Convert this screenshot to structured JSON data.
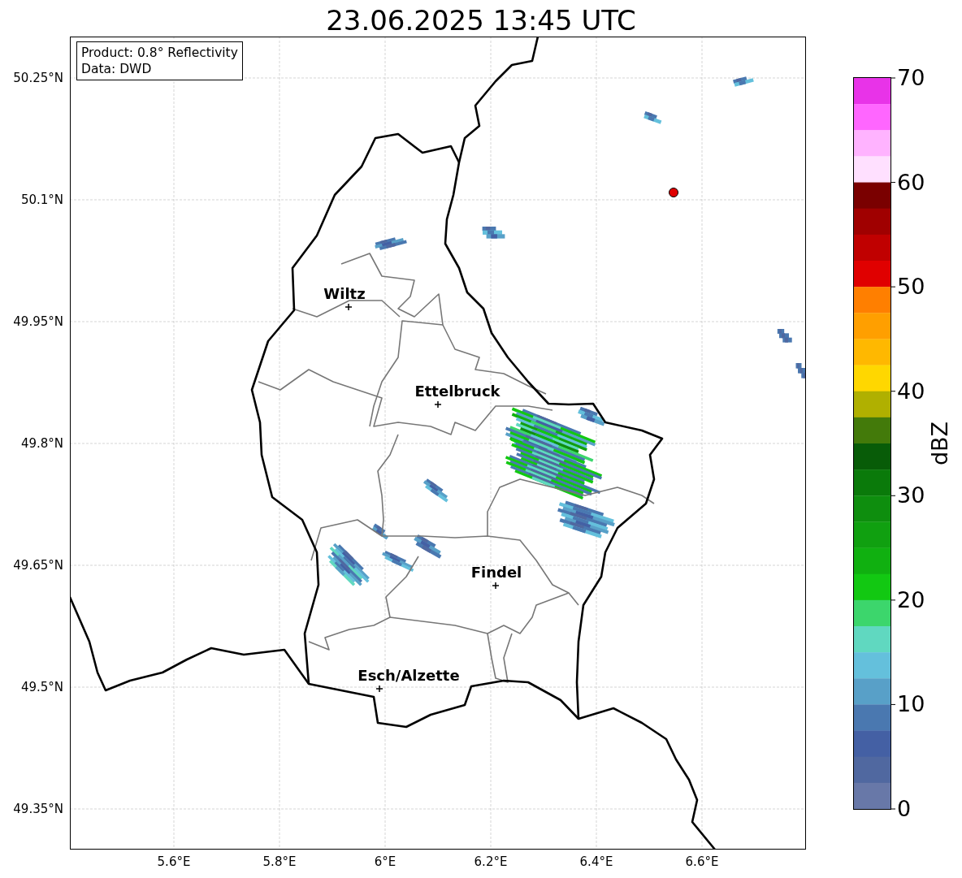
{
  "title": "23.06.2025 13:45 UTC",
  "info_box": [
    "Product: 0.8° Reflectivity",
    "Data: DWD"
  ],
  "map": {
    "x_ticks": [
      "5.6°E",
      "5.8°E",
      "6°E",
      "6.2°E",
      "6.4°E",
      "6.6°E"
    ],
    "y_ticks": [
      "50.25°N",
      "50.1°N",
      "49.95°N",
      "49.8°N",
      "49.65°N",
      "49.5°N",
      "49.35°N"
    ],
    "cities": [
      {
        "name": "Wiltz"
      },
      {
        "name": "Ettelbruck"
      },
      {
        "name": "Findel"
      },
      {
        "name": "Esch/Alzette"
      }
    ]
  },
  "colorbar": {
    "label": "dBZ",
    "ticks": [
      "70",
      "60",
      "50",
      "40",
      "30",
      "20",
      "10",
      "0"
    ],
    "segments": [
      {
        "color": "#e833e8"
      },
      {
        "color": "#ff66ff"
      },
      {
        "color": "#ffb3ff"
      },
      {
        "color": "#ffe0ff"
      },
      {
        "color": "#7a0000"
      },
      {
        "color": "#a00000"
      },
      {
        "color": "#c00000"
      },
      {
        "color": "#e00000"
      },
      {
        "color": "#ff7f00"
      },
      {
        "color": "#ff9f00"
      },
      {
        "color": "#ffb800"
      },
      {
        "color": "#ffd700"
      },
      {
        "color": "#b0b000"
      },
      {
        "color": "#437a0a"
      },
      {
        "color": "#085c08"
      },
      {
        "color": "#0a7a0a"
      },
      {
        "color": "#0e8e0e"
      },
      {
        "color": "#10a010"
      },
      {
        "color": "#10b010"
      },
      {
        "color": "#12c812"
      },
      {
        "color": "#3cd66c"
      },
      {
        "color": "#60d8c0"
      },
      {
        "color": "#64c0dc"
      },
      {
        "color": "#58a0c8"
      },
      {
        "color": "#4a78b0"
      },
      {
        "color": "#4460a4"
      },
      {
        "color": "#5068a0"
      },
      {
        "color": "#6878a8"
      }
    ]
  }
}
